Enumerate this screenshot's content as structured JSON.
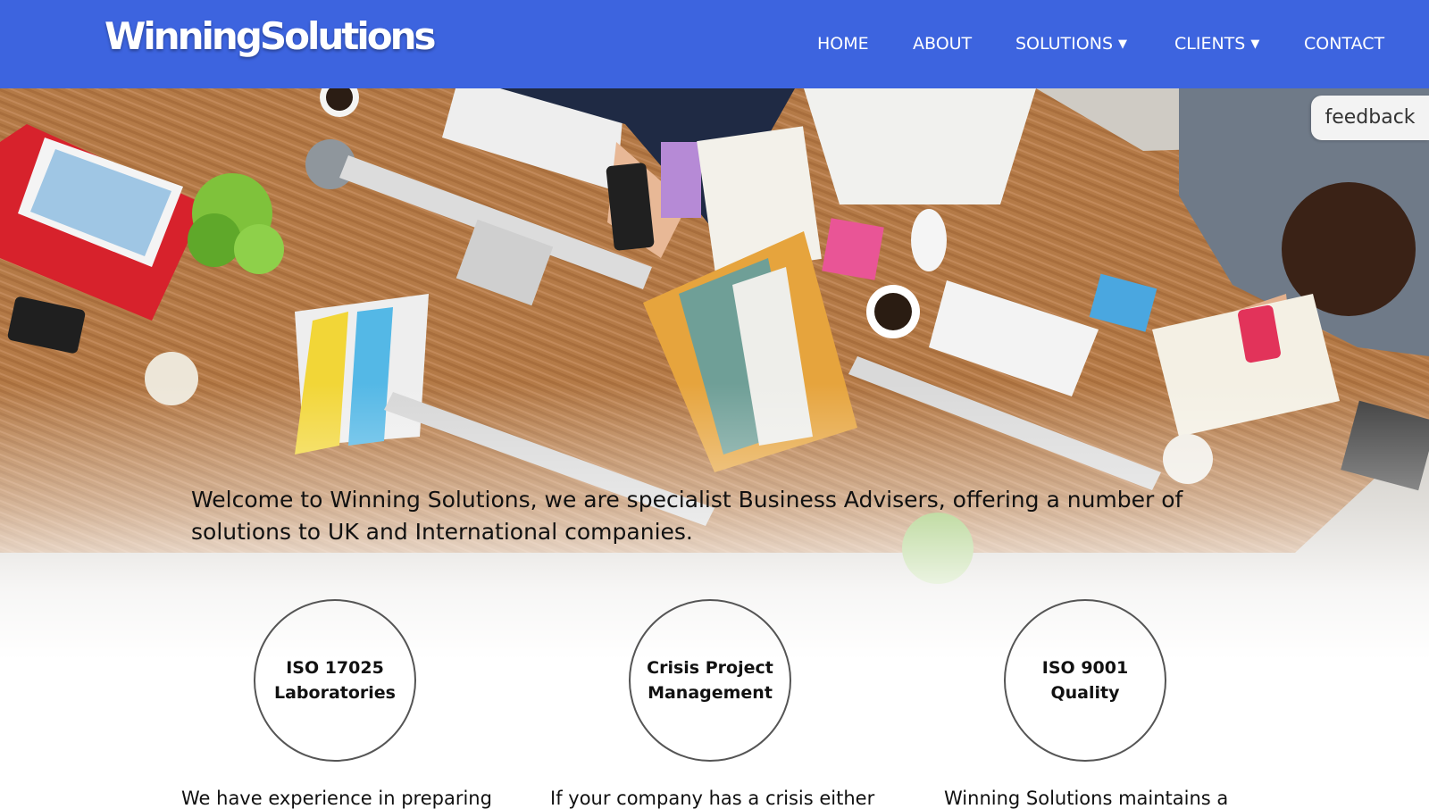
{
  "header": {
    "logo_text": "WinningSolutions",
    "nav": [
      {
        "label": "HOME",
        "dropdown": false
      },
      {
        "label": "ABOUT",
        "dropdown": false
      },
      {
        "label": "SOLUTIONS",
        "dropdown": true
      },
      {
        "label": "CLIENTS",
        "dropdown": true
      },
      {
        "label": "CONTACT",
        "dropdown": false
      }
    ],
    "caret_glyph": "▼"
  },
  "feedback_label": "feedback",
  "hero": {
    "intro_text": "Welcome to Winning Solutions, we are specialist Business Advisers, offering a number of solutions to UK and International companies."
  },
  "services": [
    {
      "title": "ISO 17025\nLaboratories",
      "teaser": "We have experience in preparing"
    },
    {
      "title": "Crisis Project\nManagement",
      "teaser": "If your company has a crisis either"
    },
    {
      "title": "ISO 9001\nQuality",
      "teaser": "Winning Solutions maintains a"
    }
  ],
  "colors": {
    "header_bg": "#3d64df",
    "nav_text": "#ffffff",
    "desk_wood": "#b47a47"
  }
}
